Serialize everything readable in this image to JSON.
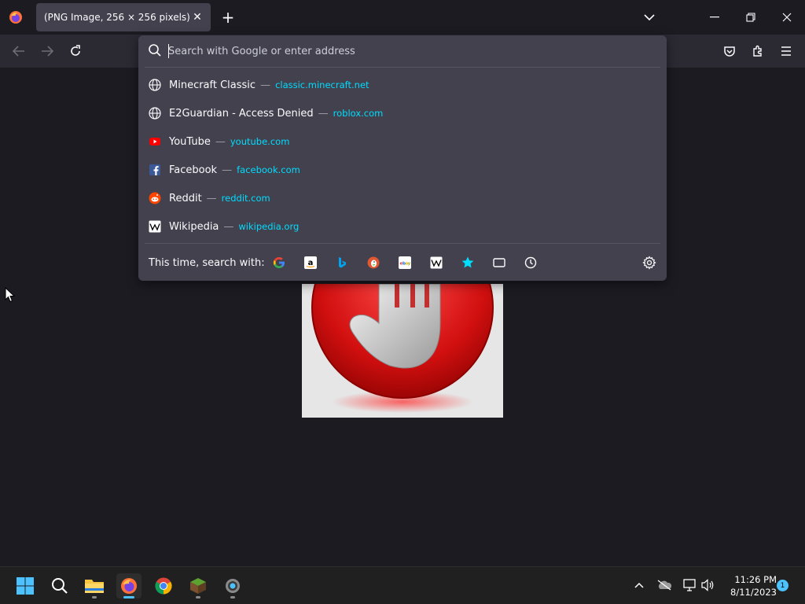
{
  "tab": {
    "title": "(PNG Image, 256 × 256 pixels)",
    "close_glyph": "✕"
  },
  "new_tab_glyph": "+",
  "urlbar": {
    "placeholder": "Search with Google or enter address",
    "value": ""
  },
  "results": [
    {
      "icon": "globe-icon",
      "title": "Minecraft Classic",
      "sep": "—",
      "url": "classic.minecraft.net"
    },
    {
      "icon": "globe-icon",
      "title": "E2Guardian - Access Denied",
      "sep": "—",
      "url": "roblox.com"
    },
    {
      "icon": "youtube-icon",
      "title": "YouTube",
      "sep": "—",
      "url": "youtube.com"
    },
    {
      "icon": "facebook-icon",
      "title": "Facebook",
      "sep": "—",
      "url": "facebook.com"
    },
    {
      "icon": "reddit-icon",
      "title": "Reddit",
      "sep": "—",
      "url": "reddit.com"
    },
    {
      "icon": "wikipedia-icon",
      "title": "Wikipedia",
      "sep": "—",
      "url": "wikipedia.org"
    }
  ],
  "oneoff": {
    "label": "This time, search with:",
    "engines": [
      "google-icon",
      "amazon-icon",
      "bing-icon",
      "duckduckgo-icon",
      "ebay-icon",
      "wikipedia-icon",
      "bookmarks-icon",
      "tabs-icon",
      "history-icon"
    ]
  },
  "clock": {
    "time": "11:26 PM",
    "date": "8/11/2023"
  },
  "notification_count": "1",
  "colors": {
    "accent": "#00ddff",
    "taskbar_accent": "#4cc2ff",
    "popup_bg": "#42414d",
    "toolbar_bg": "#2b2a33"
  }
}
